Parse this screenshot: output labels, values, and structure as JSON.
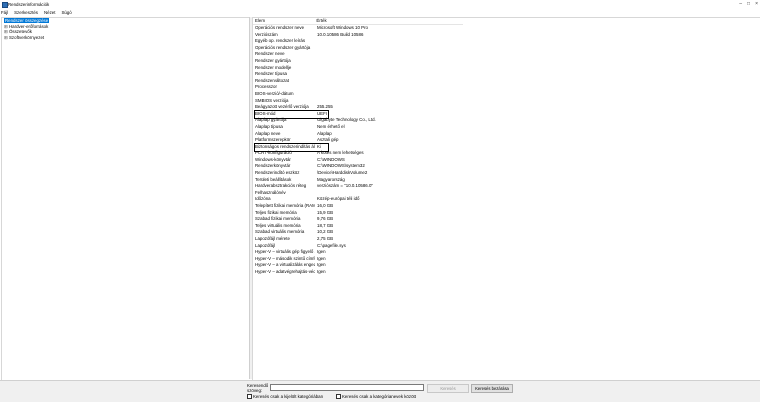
{
  "window": {
    "title": "Rendszerinformációk"
  },
  "menu": [
    "Fájl",
    "Szerkesztés",
    "Nézet",
    "Súgó"
  ],
  "tree": [
    {
      "label": "Rendszer összegzése",
      "selected": true,
      "expander": ""
    },
    {
      "label": "Hardver-erőforrások",
      "expander": "⊞"
    },
    {
      "label": "Összetevők",
      "expander": "⊞"
    },
    {
      "label": "Szoftverkörnyezet",
      "expander": "⊞"
    }
  ],
  "columns": {
    "item": "Elem",
    "value": "Érték"
  },
  "rows": [
    [
      "Operációs rendszer neve",
      "Microsoft Windows 10 Pro"
    ],
    [
      "Verziószám",
      "10.0.10586 Build 10586"
    ],
    [
      "Egyéb op. rendszer leírás",
      ""
    ],
    [
      "Operációs rendszer gyártója",
      ""
    ],
    [
      "Rendszer neve",
      ""
    ],
    [
      "Rendszer gyártója",
      ""
    ],
    [
      "Rendszer modellje",
      ""
    ],
    [
      "Rendszer típusa",
      ""
    ],
    [
      "Rendszerváltozat",
      ""
    ],
    [
      "Processzor",
      ""
    ],
    [
      "BIOS-verzió/-dátum",
      ""
    ],
    [
      "SMBIOS verziója",
      ""
    ],
    [
      "Beágyazott vezérlő verziója",
      "255.255"
    ],
    [
      "BIOS-mód",
      "UEFI"
    ],
    [
      "Alaplap gyártója",
      "Gigabyte Technology Co., Ltd."
    ],
    [
      "Alaplap típusa",
      "Nem érhető el"
    ],
    [
      "Alaplap neve",
      "Alaplap"
    ],
    [
      "Platformszerepkör",
      "Asztali gép"
    ],
    [
      "Biztonságos rendszerindítás ál...",
      "Ki"
    ],
    [
      "PCR7-konfiguráció",
      "A kötés nem lehetséges"
    ],
    [
      "Windows-könyvtár",
      "C:\\WINDOWS"
    ],
    [
      "Rendszerkönyvtár",
      "C:\\WINDOWS\\system32"
    ],
    [
      "Rendszerindító eszköz",
      "\\Device\\HarddiskVolume2"
    ],
    [
      "Területi beállítások",
      "Magyarország"
    ],
    [
      "Hardverabsztrakciós réteg",
      "verziószám = \"10.0.10586.0\""
    ],
    [
      "Felhasználónév",
      ""
    ],
    [
      "Időzóna",
      "Közép-európai téli idő"
    ],
    [
      "Telepített fizikai memória (RAM)",
      "16,0 GB"
    ],
    [
      "Teljes fizikai memória",
      "15,9 GB"
    ],
    [
      "Szabad fizikai memória",
      "9,76 GB"
    ],
    [
      "Teljes virtuális memória",
      "18,7 GB"
    ],
    [
      "Szabad virtuális memória",
      "10,2 GB"
    ],
    [
      "Lapozófájl mérete",
      "2,75 GB"
    ],
    [
      "Lapozófájl",
      "C:\\pagefile.sys"
    ],
    [
      "Hyper-V – virtuális gép figyelő ...",
      "Igen"
    ],
    [
      "Hyper-V – második szintű címfo...",
      "Igen"
    ],
    [
      "Hyper-V – a virtualizálás enged...",
      "Igen"
    ],
    [
      "Hyper-V – adatvégrehajtás-véd...",
      "Igen"
    ]
  ],
  "find": {
    "label": "Keresendő szöveg:",
    "value": "",
    "find_button": "Keresés",
    "close_button": "Keresés bezárása",
    "option_selected": "Keresés csak a kijelölt kategóriában",
    "option_names": "Keresés csak a kategórianevek között"
  }
}
